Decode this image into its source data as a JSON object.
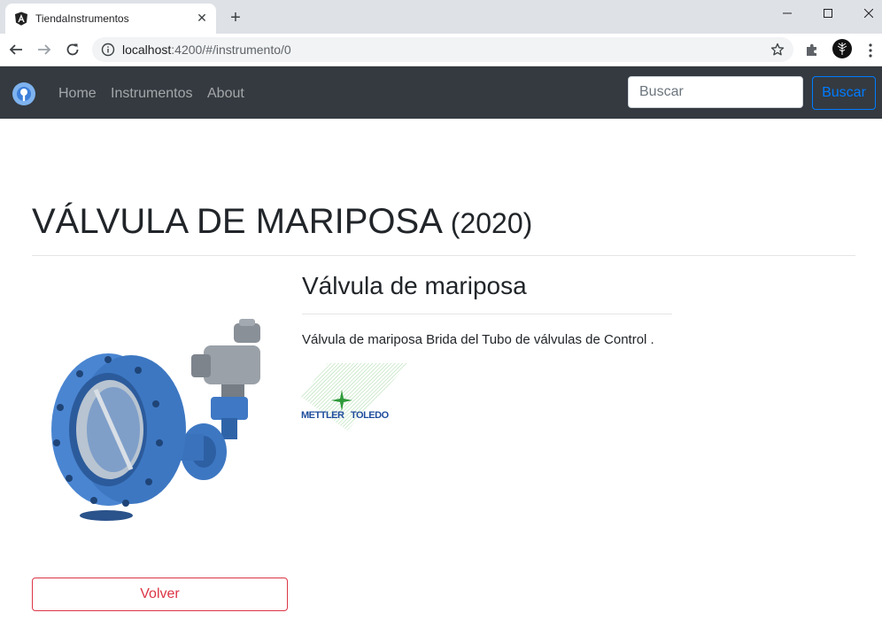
{
  "browser": {
    "tab_title": "TiendaInstrumentos",
    "url_host": "localhost",
    "url_path": ":4200/#/instrumento/0"
  },
  "navbar": {
    "links": [
      "Home",
      "Instrumentos",
      "About"
    ],
    "search_placeholder": "Buscar",
    "search_button": "Buscar"
  },
  "product": {
    "name": "VÁLVULA DE MARIPOSA",
    "year": "(2020)",
    "subtitle": "Válvula de mariposa",
    "description": "Válvula de mariposa Brida del Tubo de válvulas de Control .",
    "brand_logo_text": [
      "METTLER",
      "TOLEDO"
    ]
  },
  "actions": {
    "back_label": "Volver"
  },
  "colors": {
    "navbar_bg": "#343a40",
    "primary": "#007bff",
    "danger": "#dc3545"
  }
}
